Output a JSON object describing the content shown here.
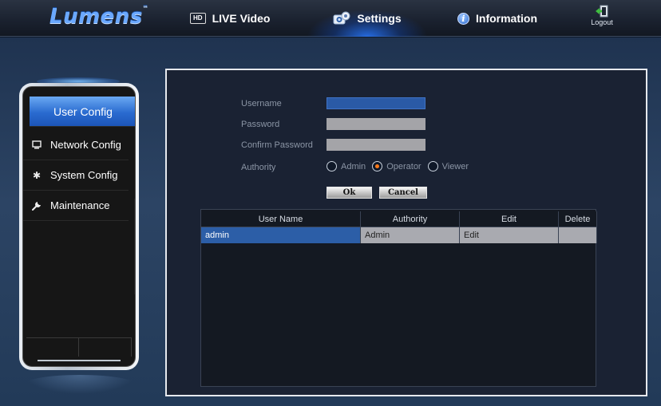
{
  "brand": {
    "logo": "Lumens",
    "tm": "™"
  },
  "nav": {
    "live_icon": "HD",
    "live_label": "LIVE Video",
    "settings_label": "Settings",
    "info_label": "Information",
    "logout_label": "Logout"
  },
  "sidebar": {
    "items": [
      {
        "label": "User Config",
        "icon": "user-config",
        "active": true
      },
      {
        "label": "Network Config",
        "icon": "monitor-icon"
      },
      {
        "label": "System Config",
        "icon": "gear-icon"
      },
      {
        "label": "Maintenance",
        "icon": "wrench-icon"
      }
    ]
  },
  "form": {
    "username_label": "Username",
    "password_label": "Password",
    "confirm_label": "Confirm Password",
    "authority_label": "Authority",
    "username_value": "",
    "password_value": "",
    "confirm_value": "",
    "authority_options": [
      "Admin",
      "Operator",
      "Viewer"
    ],
    "authority_selected": "Operator",
    "ok_label": "Ok",
    "cancel_label": "Cancel"
  },
  "table": {
    "headers": [
      "User Name",
      "Authority",
      "Edit",
      "Delete"
    ],
    "rows": [
      {
        "user": "admin",
        "authority": "Admin",
        "edit": "Edit",
        "delete": ""
      }
    ]
  },
  "colors": {
    "accent": "#2a6bd0",
    "selected_radio": "#ff7a1a"
  }
}
